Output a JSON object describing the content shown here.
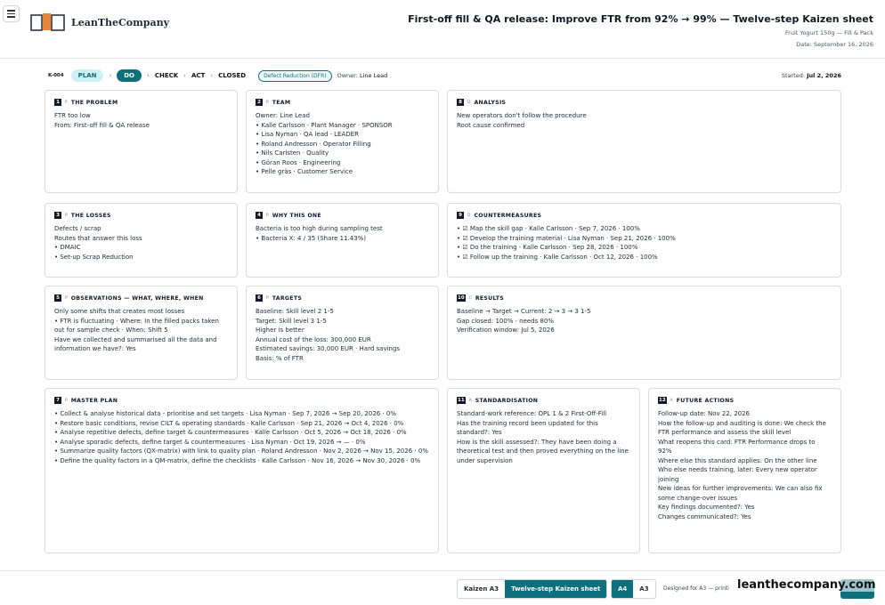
{
  "header": {
    "logo_name": "LeanTheCompany",
    "title": "First-off fill & QA release: Improve FTR from 92% → 99% — Twelve-step Kaizen sheet",
    "subtitle": "Fruit Yogurt 150g — Fill & Pack",
    "date": "Date: September 16, 2026"
  },
  "status": {
    "card_id": "K-004",
    "steps": [
      "PLAN",
      "DO",
      "CHECK",
      "ACT",
      "CLOSED"
    ],
    "sep": "›",
    "tag": "Defect Reduction (DFR)",
    "owner_label": "Owner:",
    "owner": "Line Lead",
    "started_label": "Started:",
    "started": "Jul 2, 2026"
  },
  "cards": {
    "problem": {
      "num": "1",
      "phase": "P",
      "title": "THE PROBLEM",
      "lines": [
        "FTR too low",
        "From: First-off fill & QA release"
      ]
    },
    "team": {
      "num": "2",
      "phase": "P",
      "title": "TEAM",
      "lines": [
        "Owner: Line Lead",
        "• Kalle Carlsson · Plant Manager · SPONSOR",
        "• Lisa Nyman · QA lead · LEADER",
        "• Roland Andresson · Operator Filling",
        "• Nils Carlsten · Quality",
        "• Göran Roos · Engineering",
        "• Pelle gräs · Customer Service"
      ]
    },
    "analysis": {
      "num": "8",
      "phase": "D",
      "title": "ANALYSIS",
      "lines": [
        "New operators don't follow the procedure",
        "Root cause confirmed"
      ]
    },
    "losses": {
      "num": "3",
      "phase": "P",
      "title": "THE LOSSES",
      "lines": [
        "Defects / scrap",
        "Routes that answer this loss",
        "• DMAIC",
        "• Set-up Scrap Reduction"
      ]
    },
    "why": {
      "num": "4",
      "phase": "P",
      "title": "WHY THIS ONE",
      "lines": [
        "Bacteria is too high during sampling test",
        "• Bacteria X: 4 / 35 (Share 11.43%)"
      ]
    },
    "countermeasures": {
      "num": "9",
      "phase": "D",
      "title": "COUNTERMEASURES",
      "lines": [
        "• ☑ Map the skill gap · Kalle Carlsson · Sep 7, 2026 · 100%",
        "• ☑ Develop the training material · Lisa Nyman · Sep 21, 2026 · 100%",
        "• ☑ Do the training · Kalle Carlsson · Sep 28, 2026 · 100%",
        "• ☑ Follow up the training · Kalle Carlsson · Oct 12, 2026 · 100%"
      ]
    },
    "observations": {
      "num": "5",
      "phase": "P",
      "title": "OBSERVATIONS — WHAT, WHERE, WHEN",
      "lines": [
        "Only some shifts that creates most losses",
        "• FTR is fluctuating · Where: In the filled packs taken",
        "out for sample check · When: Shift 5",
        "Have we collected and summarised all the data and",
        "information we have?: Yes"
      ]
    },
    "targets": {
      "num": "6",
      "phase": "P",
      "title": "TARGETS",
      "lines": [
        "Baseline: Skill level 2 1-5",
        "Target: Skill level 3 1-5",
        "Higher is better",
        "Annual cost of the loss: 300,000 EUR",
        "Estimated savings: 30,000 EUR · Hard savings",
        "Basis: % of FTR"
      ]
    },
    "results": {
      "num": "10",
      "phase": "C",
      "title": "RESULTS",
      "lines": [
        "Baseline → Target → Current: 2 → 3 → 3 1-5",
        "Gap closed: 100% · needs 80%",
        "Verification window: Jul 5, 2026"
      ]
    },
    "master_plan": {
      "num": "7",
      "phase": "P",
      "title": "MASTER PLAN",
      "lines": [
        "• Collect & analyse historical data - prioritise and set targets · Lisa Nyman · Sep 7, 2026 → Sep 20, 2026 · 0%",
        "• Restore basic conditions, revise CILT & operating standards · Kalle Carlsson · Sep 21, 2026 → Oct 4, 2026 · 0%",
        "• Analyse repetitive defects, define target & countermeasures · Kalle Carlsson · Oct 5, 2026 → Oct 18, 2026 · 0%",
        "• Analyse sporadic defects, define target & countermeasures · Lisa Nyman · Oct 19, 2026 → — · 0%",
        "• Summarize quality factors (QX-matrix) with link to quality plan · Roland Andresson · Nov 2, 2026 → Nov 15, 2026 · 0%",
        "• Define the quality factors in a QM-matrix, define the checklists · Kalle Carlsson · Nov 16, 2026 → Nov 30, 2026 · 0%"
      ]
    },
    "standardisation": {
      "num": "11",
      "phase": "A",
      "title": "STANDARDISATION",
      "lines": [
        "Standard-work reference: OPL 1 & 2 First-Off-Fill",
        "Has the training record been updated for this",
        "standard?: Yes",
        "How is the skill assessed?: They have been doing a",
        "theoretical test and then proved everything on the line",
        "under supervision"
      ]
    },
    "future": {
      "num": "12",
      "phase": "A",
      "title": "FUTURE ACTIONS",
      "lines": [
        "Follow-up date: Nov 22, 2026",
        "How the follow-up and auditing is done: We check the",
        "FTR performance and assess the skill level",
        "What reopens this card: FTR Performance drops to",
        "92%",
        "Where else this standard applies: On the other line",
        "Who else needs training, later: Every new operator",
        "joining",
        "New ideas for further improvements: We can also fix",
        "some change-over issues",
        "Key findings documented?: Yes",
        "Changes communicated?: Yes"
      ]
    }
  },
  "footer": {
    "sheet_options": [
      "Kaizen A3",
      "Twelve-step Kaizen sheet"
    ],
    "size_options": [
      "A4",
      "A3"
    ],
    "designed": "Designed for A3 — printi",
    "watermark": "leanthecompany.com"
  },
  "colors": {
    "accent": "#0e6f7d",
    "accent_light": "#cdf1f3",
    "border": "#d6dbe0"
  }
}
